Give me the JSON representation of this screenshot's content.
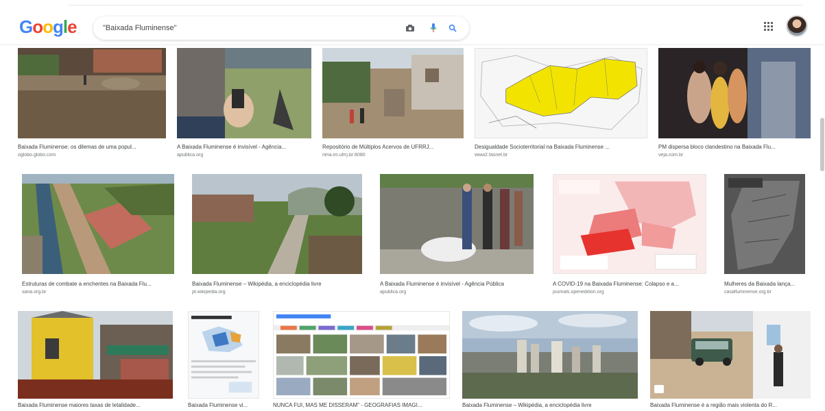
{
  "header": {
    "logo": [
      "G",
      "o",
      "o",
      "g",
      "l",
      "e"
    ],
    "search_value": "\"Baixada Fluminense\""
  },
  "icons": {
    "camera": "camera-icon",
    "mic": "microphone-icon",
    "search": "search-icon",
    "apps": "apps-grid-icon",
    "avatar": "account-avatar"
  },
  "results": [
    {
      "title": "Baixada Fluminense: os dilemas de uma popul...",
      "source": "oglobo.globo.com"
    },
    {
      "title": "A Baixada Fluminense é invisível - Agência...",
      "source": "apublica.org"
    },
    {
      "title": "Repositório de Múltiplos Acervos de UFRRJ...",
      "source": "rima.im.ufrrj.br:8080"
    },
    {
      "title": "Desigualdade Socioterritorial na Baixada Fluminense ...",
      "source": "www2.fasnet.br"
    },
    {
      "title": "PM dispersa bloco clandestino na Baixada Flu...",
      "source": "veja.com.br"
    },
    {
      "title": "Estruturas de combate a enchentes na Baixada Flu...",
      "source": "sana.org.br"
    },
    {
      "title": "Baixada Fluminense – Wikipédia, a enciclopédia livre",
      "source": "pt.wikipedia.org"
    },
    {
      "title": "A Baixada Fluminense é invisível - Agência Pública",
      "source": "apublica.org"
    },
    {
      "title": "A COVID-19 na Baixada Fluminense: Colapso e a...",
      "source": "journals.openedition.org"
    },
    {
      "title": "Mulheres da Baixada lança...",
      "source": "casafluminense.org.br"
    },
    {
      "title": "Baixada Fluminense maiores taxas de letalidade...",
      "source": ""
    },
    {
      "title": "Baixada Fluminense vi...",
      "source": ""
    },
    {
      "title": "NUNCA FUI, MAS ME DISSERAM\" - GEOGRAFIAS IMAGI...",
      "source": ""
    },
    {
      "title": "Baixada Fluminense – Wikipédia, a enciclopédia livre",
      "source": ""
    },
    {
      "title": "Baixada Fluminense é a região mais violenta do R...",
      "source": ""
    }
  ]
}
